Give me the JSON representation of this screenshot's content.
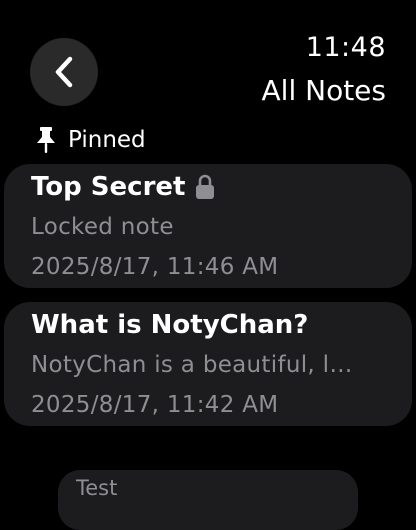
{
  "status": {
    "time": "11:48"
  },
  "nav": {
    "title": "All Notes",
    "back_icon": "chevron-left-icon"
  },
  "pinned_section": {
    "label": "Pinned",
    "icon": "pin-icon"
  },
  "notes": [
    {
      "title": "Top Secret",
      "locked": true,
      "preview": "Locked note",
      "date": "2025/8/17, 11:46 AM"
    },
    {
      "title": "What is NotyChan?",
      "locked": false,
      "preview": "NotyChan is a beautiful, l…",
      "date": "2025/8/17, 11:42 AM"
    }
  ],
  "next_item": {
    "title": "Test"
  },
  "colors": {
    "background": "#000000",
    "card": "#1c1c1e",
    "secondary_text": "#8e8e93",
    "back_button": "#2a2a2a"
  }
}
